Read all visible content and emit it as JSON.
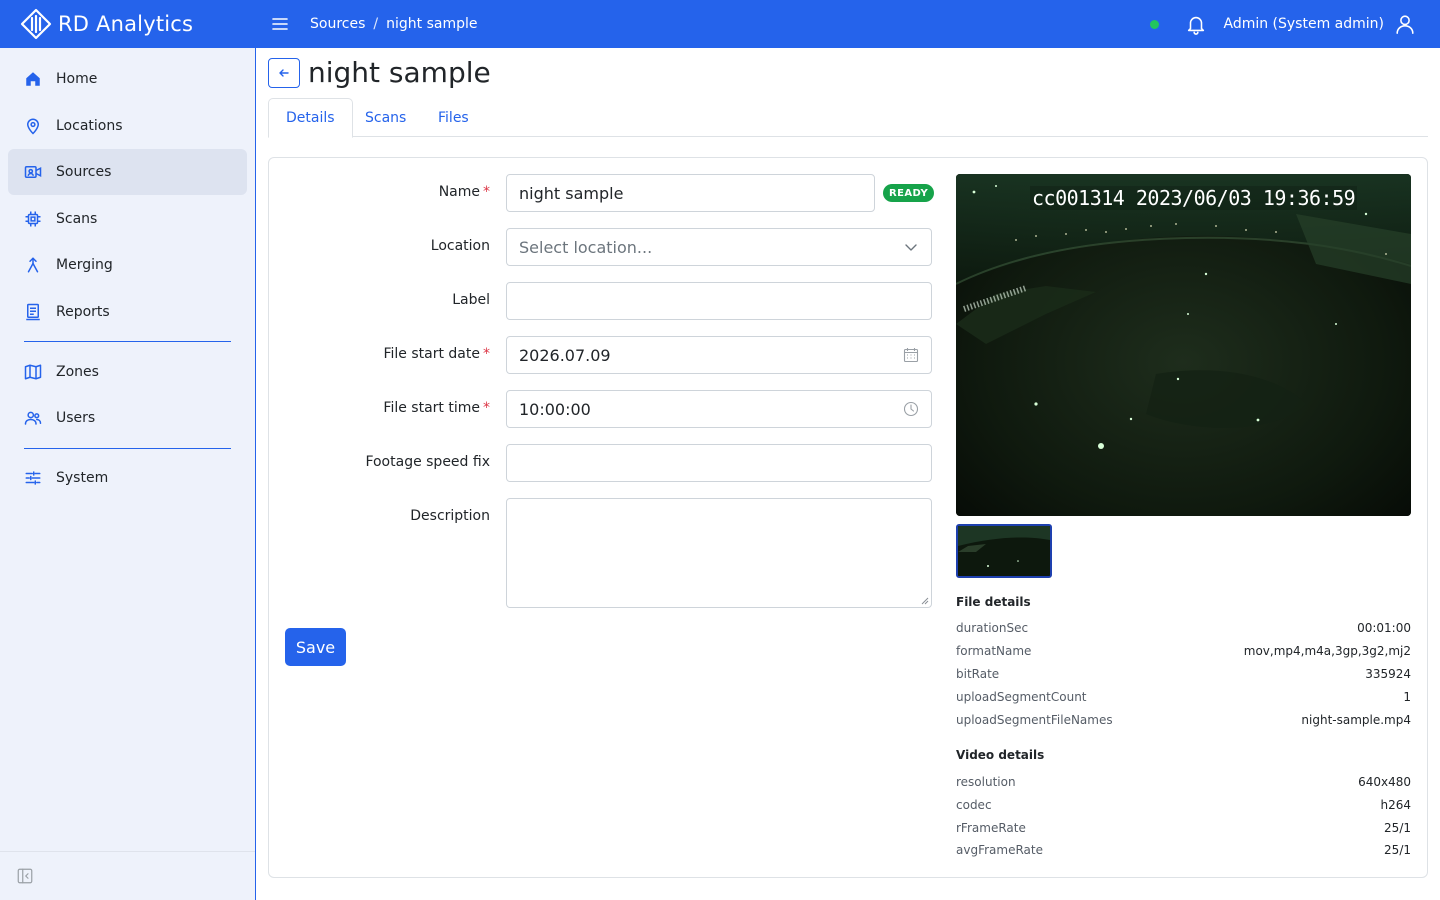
{
  "app": {
    "brand_name": "RD Analytics",
    "accent_color": "#2563eb",
    "status_color": "#22c55e"
  },
  "header": {
    "breadcrumb": [
      "Sources",
      "night sample"
    ],
    "user_label": "Admin (System admin)"
  },
  "sidebar": {
    "items": [
      {
        "label": "Home",
        "icon": "home-icon"
      },
      {
        "label": "Locations",
        "icon": "map-pin-icon"
      },
      {
        "label": "Sources",
        "icon": "camera-source-icon",
        "active": true
      },
      {
        "label": "Scans",
        "icon": "chip-icon"
      },
      {
        "label": "Merging",
        "icon": "merge-icon"
      },
      {
        "label": "Reports",
        "icon": "report-icon"
      },
      {
        "label": "Zones",
        "icon": "map-icon"
      },
      {
        "label": "Users",
        "icon": "users-icon"
      },
      {
        "label": "System",
        "icon": "sliders-icon"
      }
    ]
  },
  "page": {
    "title": "night sample",
    "tabs": [
      {
        "label": "Details",
        "active": true
      },
      {
        "label": "Scans"
      },
      {
        "label": "Files"
      }
    ]
  },
  "form": {
    "name_label": "Name",
    "name_value": "night sample",
    "status_badge": "READY",
    "location_label": "Location",
    "location_placeholder": "Select location...",
    "label_label": "Label",
    "label_value": "",
    "start_date_label": "File start date",
    "start_date_value": "2026.07.09",
    "start_time_label": "File start time",
    "start_time_value": "10:00:00",
    "speed_fix_label": "Footage speed fix",
    "speed_fix_value": "",
    "description_label": "Description",
    "save_label": "Save"
  },
  "video": {
    "overlay_text": "cc001314  2023/06/03  19:36:59"
  },
  "file_details": {
    "title": "File details",
    "rows": [
      {
        "key": "durationSec",
        "value": "00:01:00"
      },
      {
        "key": "formatName",
        "value": "mov,mp4,m4a,3gp,3g2,mj2"
      },
      {
        "key": "bitRate",
        "value": "335924"
      },
      {
        "key": "uploadSegmentCount",
        "value": "1"
      },
      {
        "key": "uploadSegmentFileNames",
        "value": "night-sample.mp4"
      }
    ]
  },
  "video_details": {
    "title": "Video details",
    "rows": [
      {
        "key": "resolution",
        "value": "640x480"
      },
      {
        "key": "codec",
        "value": "h264"
      },
      {
        "key": "rFrameRate",
        "value": "25/1"
      },
      {
        "key": "avgFrameRate",
        "value": "25/1"
      }
    ]
  }
}
